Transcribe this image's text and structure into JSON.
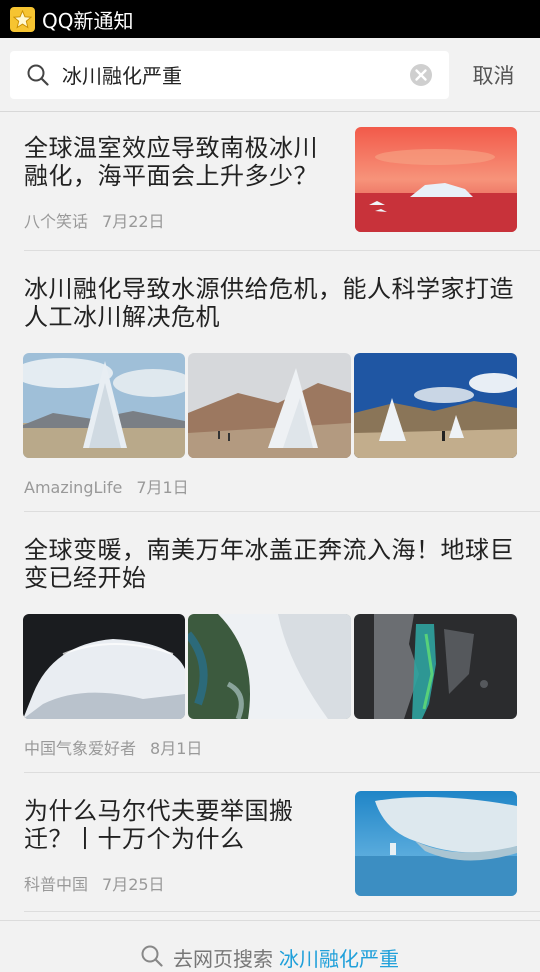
{
  "status_bar": {
    "app_name": "QQ新通知"
  },
  "search": {
    "query": "冰川融化严重",
    "cancel_label": "取消"
  },
  "results": [
    {
      "title": "全球温室效应导致南极冰川融化，海平面会上升多少？",
      "source": "八个笑话",
      "date": "7月22日"
    },
    {
      "title": "冰川融化导致水源供给危机，能人科学家打造人工冰川解决危机",
      "source": "AmazingLife",
      "date": "7月1日"
    },
    {
      "title": "全球变暖，南美万年冰盖正奔流入海！地球巨变已经开始",
      "source": "中国气象爱好者",
      "date": "8月1日"
    },
    {
      "title": "为什么马尔代夫要举国搬迁？丨十万个为什么",
      "source": "科普中国",
      "date": "7月25日"
    }
  ],
  "footer": {
    "prefix": "去网页搜索",
    "keyword": "冰川融化严重"
  }
}
